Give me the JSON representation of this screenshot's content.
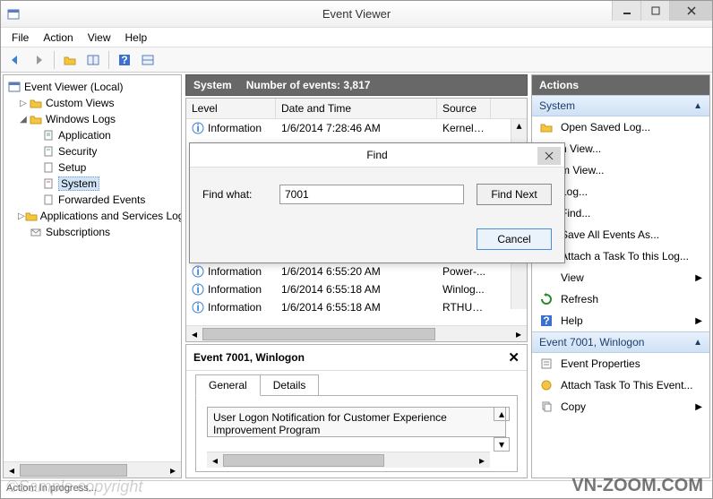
{
  "window": {
    "title": "Event Viewer"
  },
  "menu": {
    "file": "File",
    "action": "Action",
    "view": "View",
    "help": "Help"
  },
  "tree": {
    "root": "Event Viewer (Local)",
    "custom_views": "Custom Views",
    "windows_logs": "Windows Logs",
    "application": "Application",
    "security": "Security",
    "setup": "Setup",
    "system": "System",
    "forwarded": "Forwarded Events",
    "apps_services": "Applications and Services Logs",
    "subscriptions": "Subscriptions"
  },
  "list": {
    "title": "System",
    "count_label": "Number of events: 3,817",
    "col_level": "Level",
    "col_datetime": "Date and Time",
    "col_source": "Source",
    "rows": [
      {
        "level": "Information",
        "dt": "1/6/2014 7:28:46 AM",
        "src": "Kernel-..."
      },
      {
        "level": "Information",
        "dt": "1/6/2014 6:55:20 AM",
        "src": "Power-..."
      },
      {
        "level": "Information",
        "dt": "1/6/2014 6:55:18 AM",
        "src": "Winlog..."
      },
      {
        "level": "Information",
        "dt": "1/6/2014 6:55:18 AM",
        "src": "RTHUSB"
      }
    ]
  },
  "detail": {
    "header": "Event 7001, Winlogon",
    "tab_general": "General",
    "tab_details": "Details",
    "message": "User Logon Notification for Customer Experience Improvement Program"
  },
  "actions": {
    "header": "Actions",
    "section1": "System",
    "open_saved": "Open Saved Log...",
    "create_view": "n View...",
    "import_view": "m View...",
    "clear_log": "Log...",
    "find": "Find...",
    "save_all": "Save All Events As...",
    "attach_task": "Attach a Task To this Log...",
    "view": "View",
    "refresh": "Refresh",
    "help": "Help",
    "section2": "Event 7001, Winlogon",
    "event_props": "Event Properties",
    "attach_task_event": "Attach Task To This Event...",
    "copy": "Copy"
  },
  "find_dialog": {
    "title": "Find",
    "label": "Find what:",
    "value": "7001",
    "find_next": "Find Next",
    "cancel": "Cancel"
  },
  "status": "Action: In progress...",
  "watermark1": "©Sample copyright",
  "watermark2": "VN-ZOOM.COM"
}
